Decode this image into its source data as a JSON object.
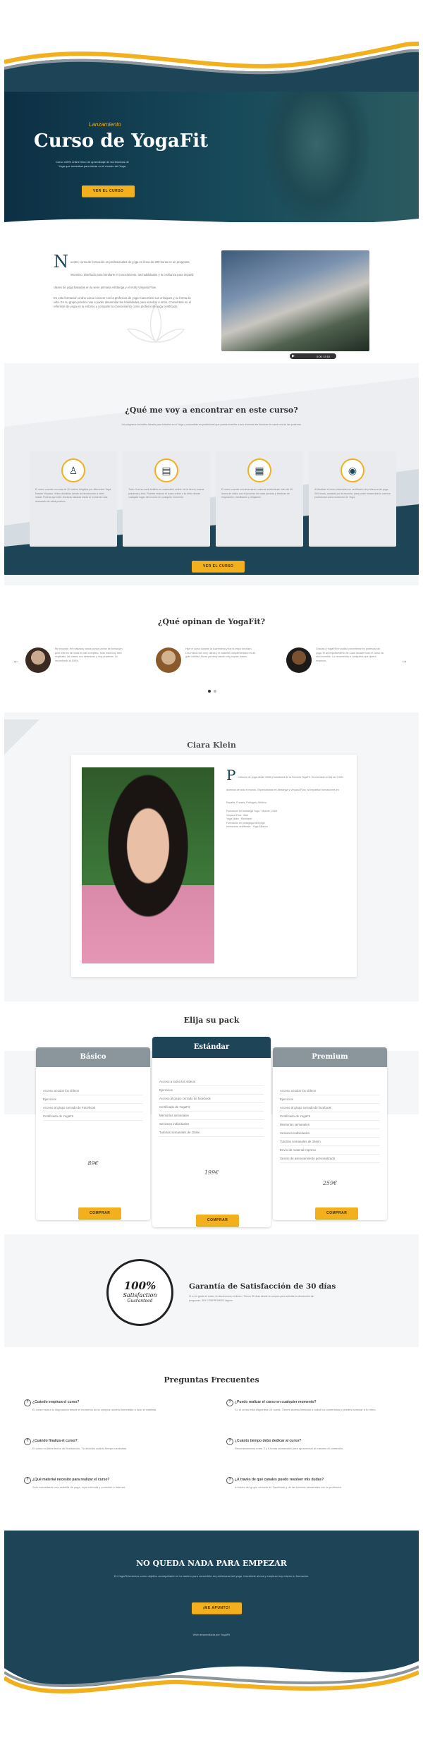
{
  "hero": {
    "kicker": "Lanzamiento",
    "title": "Curso de YogaFit",
    "subtitle": "Curso 100% online lleno de aprendizaje de las técnicas de Yoga que necesitas para iniciar en el mundo del Yoga.",
    "cta": "VER EL CURSO"
  },
  "intro": {
    "dropcap": "N",
    "text": "uestro curso de formación en profesionales de yoga en línea de 200 horas es un programa intensivo, diseñado para brindarte el conocimiento, las habilidades y la confianza para impartir clases de yoga basadas en la serie primaria Ashtanga y el estilo Vinyasa Flow.",
    "text2": "En esta formación online vas a conocer con la profesora de yoga Ciara Klein sus enfoques y su forma de vida. En su grupo práctico vas a poder desarrollar las habilidades para enseñar a otros. Conviértete en el referente de yoga en tu entorno y comparte tu conocimiento como profesor de yoga certificado.",
    "video_time": "0:00 / 2:15"
  },
  "learn": {
    "title": "¿Qué me voy a encontrar en este curso?",
    "intro": "Un programa formativo ideado para iniciarte en el Yoga y convertirte en profesional que pueda enseñar a sus alumnos las técnicas de cada una de las posturas.",
    "cards": [
      {
        "icon": "person-icon",
        "glyph": "♙",
        "text": "El curso cuenta con más de 20 vídeos dirigidos por diferentes Yoga Master Vinyasa. Vídeo divididos desde la introducción a nivel inicial. Podrás aprender técnicas básicas hasta el momento más avanzado de cada postura."
      },
      {
        "icon": "book-icon",
        "glyph": "▤",
        "text": "Todo el curso está dividido en materiales online: de la teoría, tareas prácticas y test. Puedes realizar el curso online a tu ritmo desde cualquier lugar del mundo en cualquier momento."
      },
      {
        "icon": "chart-icon",
        "glyph": "▦",
        "text": "El curso cuenta con abundante material audiovisual: más de 30 horas de vídeo con el proceso de cada postura y técnicas de respiración, meditación y relajación."
      },
      {
        "icon": "eye-icon",
        "glyph": "◉",
        "text": "Al finalizar el curso obtendrás un certificado de profesora de yoga 200 horas, avalado por la escuela, para poder desarrollar tu carrera profesional como instructor de Yoga."
      }
    ],
    "cta": "VER EL CURSO"
  },
  "testimonials": {
    "title": "¿Qué opinan de YogaFit?",
    "items": [
      {
        "text": "Me encantó. He realizado varios cursos online de formación, pero este es sin duda el más completo. Todo está muy bien explicado, las clases son dinámicas y muy prácticas. Lo recomiendo al 100%."
      },
      {
        "text": "Hice el curso durante la cuarentena y fue la mejor decisión. Los vídeos son muy claros y el material complementario es de gran calidad. Ahora ya estoy dando mis propias clases."
      },
      {
        "text": "Gracias a YogaFit he podido convertirme en profesora de yoga. El acompañamiento de Ciara durante todo el curso ha sido increíble. Lo recomiendo a cualquiera que quiera empezar."
      }
    ]
  },
  "teacher": {
    "name": "Ciara Klein",
    "dropcap": "P",
    "bio": "rofesora de yoga desde 2006 y fundadora de la Escuela YogaFit. Ha formado a más de 2.000 alumnos de todo el mundo. Especializada en Ashtanga y Vinyasa Flow, ha impartido formaciones en España, Francia, Portugal y México.",
    "creds": [
      "Formación en Ashtanga Yoga · Mysore, 2008",
      "Vinyasa Flow · Bali",
      "Yoga Nidra · Rishikesh",
      "Formación en pedagogía del yoga",
      "Instructora certificada · Yoga Alliance"
    ]
  },
  "pricing": {
    "title": "Elija su pack",
    "plans": [
      {
        "name": "Básico",
        "features": [
          "Acceso a todos los vídeos",
          "Ejercicios",
          "Acceso al grupo cerrado de Facebook",
          "Certificado de YogaFit"
        ],
        "price": "89€",
        "cta": "COMPRAR"
      },
      {
        "name": "Estándar",
        "features": [
          "Acceso a todos los vídeos",
          "Ejercicios",
          "Acceso al grupo cerrado de facebook",
          "Certificado de YogaFit",
          "Mentorías semanales",
          "Sesiones individuales",
          "Tutorías semanales de 15min"
        ],
        "price": "199€",
        "cta": "COMPRAR"
      },
      {
        "name": "Premium",
        "features": [
          "Acceso a todos los vídeos",
          "Ejercicios",
          "Acceso al grupo cerrado de facebook",
          "Certificado de YogaFit",
          "Mentorías semanales",
          "Sesiones individuales",
          "Tutorías semanales de 15min",
          "Envío de material impreso",
          "Sesión de asesoramiento personalizado"
        ],
        "price": "259€",
        "cta": "COMPRAR"
      }
    ]
  },
  "guarantee": {
    "badge_pct": "100%",
    "badge_l1": "Satisfaction",
    "badge_l2": "Guaranteed",
    "title": "Garantía de Satisfacción de 30 días",
    "text": "Si no te gusta el curso, te devolvemos el dinero. Tienes 30 días desde la compra para solicitar la devolución sin preguntas. SIN COMPROMISO alguno."
  },
  "faq": {
    "title": "Preguntas Frecuentes",
    "items": [
      {
        "q": "¿Cuándo empieza el curso?",
        "a": "El curso está a tu disposición desde el momento de la compra: acceso inmediato a todo el material."
      },
      {
        "q": "¿Puedo realizar el curso en cualquier momento?",
        "a": "Sí, el curso está disponible 24 horas. Tienes acceso ilimitado a todos los contenidos y puedes avanzar a tu ritmo."
      },
      {
        "q": "¿Cuándo finaliza el curso?",
        "a": "El curso no tiene fecha de finalización. Tú decides cuánto tiempo necesitas."
      },
      {
        "q": "¿Cuánto tiempo debo dedicar al curso?",
        "a": "Recomendamos entre 3 y 5 horas semanales para aprovechar al máximo el contenido."
      },
      {
        "q": "¿Qué material necesito para realizar el curso?",
        "a": "Solo necesitarás una esterilla de yoga, ropa cómoda y conexión a internet."
      },
      {
        "q": "¿A través de qué canales puedo resolver mis dudas?",
        "a": "A través del grupo cerrado de Facebook y de las tutorías semanales con la profesora."
      }
    ]
  },
  "final": {
    "title": "NO QUEDA NADA PARA EMPEZAR",
    "text": "En YogaFit tenemos como objetivo acompañarte en tu camino para convertirte en profesional del yoga. Inscríbete ahora y empieza hoy mismo tu formación.",
    "cta": "¡ME APUNTO!",
    "credit": "Web desarrollada por YogaFit"
  },
  "colors": {
    "navy": "#1d4457",
    "accent": "#f2b01e"
  }
}
